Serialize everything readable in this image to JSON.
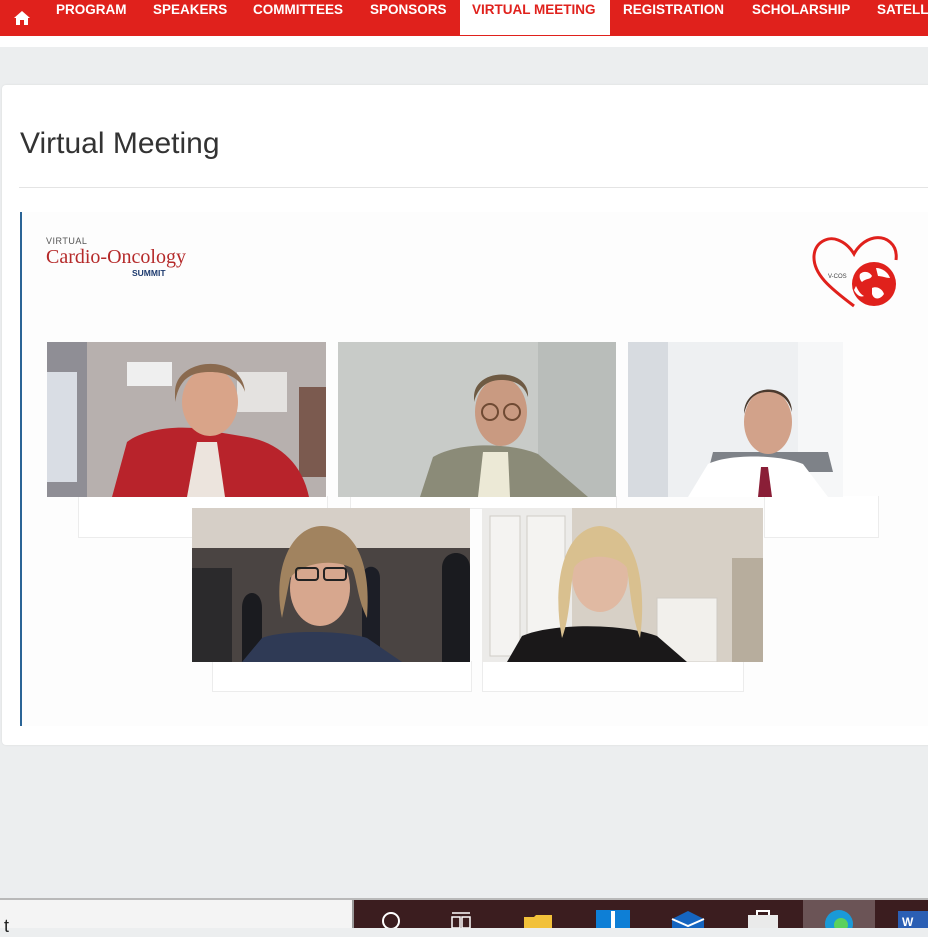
{
  "nav": {
    "home_icon": "home-icon",
    "items": [
      "PROGRAM",
      "SPEAKERS",
      "COMMITTEES",
      "SPONSORS",
      "VIRTUAL MEETING",
      "REGISTRATION",
      "SCHOLARSHIP",
      "SATELL"
    ],
    "active": "VIRTUAL MEETING",
    "color": "#e0211c"
  },
  "page": {
    "title": "Virtual Meeting"
  },
  "video": {
    "event_logo": {
      "line1": "VIRTUAL",
      "line2": "Cardio-Oncology",
      "line3": "SUMMIT"
    },
    "corner_logo": {
      "text": "V-COS",
      "color": "#e0211c"
    },
    "participants": [
      {
        "name": "participant-1"
      },
      {
        "name": "participant-2"
      },
      {
        "name": "participant-3"
      },
      {
        "name": "participant-4"
      },
      {
        "name": "participant-5"
      }
    ]
  },
  "taskbar": {
    "search_text": "t",
    "icons": [
      "search-icon",
      "task-view-icon",
      "file-explorer-icon",
      "app-icon",
      "mail-icon",
      "store-icon",
      "edge-icon",
      "word-icon"
    ]
  }
}
